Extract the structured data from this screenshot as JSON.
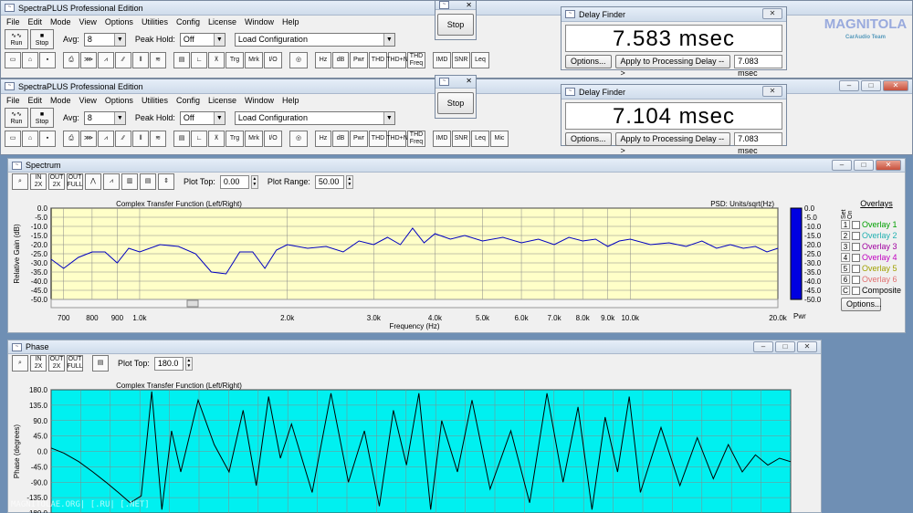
{
  "app": {
    "title": "SpectraPLUS Professional Edition"
  },
  "menu": [
    "File",
    "Edit",
    "Mode",
    "View",
    "Options",
    "Utilities",
    "Config",
    "License",
    "Window",
    "Help"
  ],
  "toolbar": {
    "run": "Run",
    "stop": "Stop",
    "avg_label": "Avg:",
    "avg_value": "8",
    "peak_label": "Peak Hold:",
    "peak_value": "Off",
    "load_config": "Load Configuration",
    "buttons": [
      "Hz",
      "dB",
      "Pwr",
      "THD",
      "THD+N",
      "THD Freq",
      "IMD",
      "SNR",
      "Leq",
      "Mic"
    ]
  },
  "stop_window": {
    "label": "Stop"
  },
  "delay_finder": {
    "title": "Delay Finder",
    "top_value": "7.583 msec",
    "bottom_value": "7.104 msec",
    "options": "Options...",
    "apply": "Apply to Processing Delay -->",
    "delay_box": "7.083 msec"
  },
  "logo": {
    "text": "MAGNITOLA",
    "sub": "CarAudio Team"
  },
  "watermark": "MAGNITOLAE.ORG| [.RU| [.NET]",
  "spectrum": {
    "title": "Spectrum",
    "plot_top_label": "Plot Top:",
    "plot_top": "0.00",
    "plot_range_label": "Plot Range:",
    "plot_range": "50.00",
    "toolbar_icons": [
      "IN 2X",
      "OUT 2X",
      "OUT FULL"
    ],
    "overlays_title": "Overlays",
    "set_label": "Set",
    "on_label": "On",
    "composite": "Composite",
    "options_btn": "Options...",
    "overlays": [
      {
        "n": "1",
        "name": "Overlay 1",
        "color": "#00a000"
      },
      {
        "n": "2",
        "name": "Overlay 2",
        "color": "#20b0b0"
      },
      {
        "n": "3",
        "name": "Overlay 3",
        "color": "#a000a0"
      },
      {
        "n": "4",
        "name": "Overlay 4",
        "color": "#c000c0"
      },
      {
        "n": "5",
        "name": "Overlay 5",
        "color": "#a0a000"
      },
      {
        "n": "6",
        "name": "Overlay 6",
        "color": "#e07070"
      }
    ],
    "pwr": "Pwr"
  },
  "phase": {
    "title": "Phase",
    "plot_top_label": "Plot Top:",
    "plot_top": "180.0",
    "toolbar_icons": [
      "IN 2X",
      "OUT 2X",
      "OUT FULL"
    ]
  },
  "chart_data": [
    {
      "type": "line",
      "title": "Complex Transfer Function (Left/Right)",
      "subtitle": "PSD: Units/sqrt(Hz)",
      "xlabel": "Frequency (Hz)",
      "ylabel": "Relative Gain (dB)",
      "ylim": [
        -50,
        0
      ],
      "yticks": [
        "0.0",
        "-5.0",
        "-10.0",
        "-15.0",
        "-20.0",
        "-25.0",
        "-30.0",
        "-35.0",
        "-40.0",
        "-45.0",
        "-50.0"
      ],
      "xticks": [
        "700",
        "800",
        "900",
        "1.0k",
        "2.0k",
        "3.0k",
        "4.0k",
        "5.0k",
        "6.0k",
        "7.0k",
        "8.0k",
        "9.0k",
        "10.0k",
        "20.0k"
      ],
      "xtick_values": [
        700,
        800,
        900,
        1000,
        2000,
        3000,
        4000,
        5000,
        6000,
        7000,
        8000,
        9000,
        10000,
        20000
      ],
      "xlim": [
        660,
        20000
      ],
      "x_scale": "log",
      "grid": true,
      "plot_bg": "#ffffc8",
      "line_color": "#0000c0",
      "series": [
        {
          "x": [
            660,
            700,
            750,
            800,
            850,
            900,
            950,
            1000,
            1100,
            1200,
            1300,
            1400,
            1500,
            1600,
            1700,
            1800,
            1900,
            2000,
            2200,
            2400,
            2600,
            2800,
            3000,
            3200,
            3400,
            3600,
            3800,
            4000,
            4300,
            4600,
            5000,
            5500,
            6000,
            6500,
            7000,
            7500,
            8000,
            8500,
            9000,
            9500,
            10000,
            11000,
            12000,
            13000,
            14000,
            15000,
            16000,
            17000,
            18000,
            19000,
            20000
          ],
          "y": [
            -28,
            -33,
            -27,
            -24,
            -24,
            -30,
            -22,
            -24,
            -20,
            -21,
            -25,
            -35,
            -36,
            -24,
            -24,
            -33,
            -23,
            -20,
            -22,
            -21,
            -24,
            -18,
            -20,
            -16,
            -20,
            -11,
            -19,
            -14,
            -17,
            -15,
            -18,
            -16,
            -19,
            -17,
            -20,
            -16,
            -18,
            -17,
            -21,
            -18,
            -17,
            -20,
            -19,
            -21,
            -18,
            -22,
            -20,
            -22,
            -21,
            -24,
            -22
          ]
        }
      ]
    },
    {
      "type": "line",
      "title": "Complex Transfer Function (Left/Right)",
      "ylabel": "Phase (degrees)",
      "ylim": [
        -180,
        180
      ],
      "yticks": [
        "180.0",
        "135.0",
        "90.0",
        "45.0",
        "0.0",
        "-45.0",
        "-90.0",
        "-135.0",
        "-180.0"
      ],
      "xlim": [
        660,
        20000
      ],
      "x_scale": "log",
      "grid": true,
      "plot_bg": "#00f0f0",
      "line_color": "#000000",
      "series": [
        {
          "x": [
            660,
            700,
            750,
            800,
            850,
            900,
            950,
            1000,
            1050,
            1100,
            1150,
            1200,
            1300,
            1400,
            1500,
            1600,
            1700,
            1800,
            1900,
            2000,
            2200,
            2400,
            2600,
            2800,
            3000,
            3200,
            3400,
            3600,
            3800,
            4000,
            4300,
            4600,
            5000,
            5500,
            6000,
            6500,
            7000,
            7500,
            8000,
            8500,
            9000,
            9500,
            10000,
            11000,
            12000,
            13000,
            14000,
            15000,
            16000,
            17000,
            18000,
            19000,
            20000
          ],
          "y": [
            10,
            -5,
            -30,
            -60,
            -90,
            -120,
            -150,
            -130,
            175,
            -170,
            60,
            -60,
            150,
            20,
            -60,
            120,
            -100,
            160,
            -20,
            80,
            -120,
            170,
            -90,
            60,
            -160,
            120,
            -40,
            170,
            -170,
            90,
            -60,
            150,
            -110,
            60,
            -150,
            170,
            -90,
            130,
            -170,
            100,
            -60,
            160,
            -120,
            70,
            -100,
            40,
            -80,
            20,
            -60,
            -10,
            -40,
            -20,
            -30
          ]
        }
      ]
    }
  ]
}
